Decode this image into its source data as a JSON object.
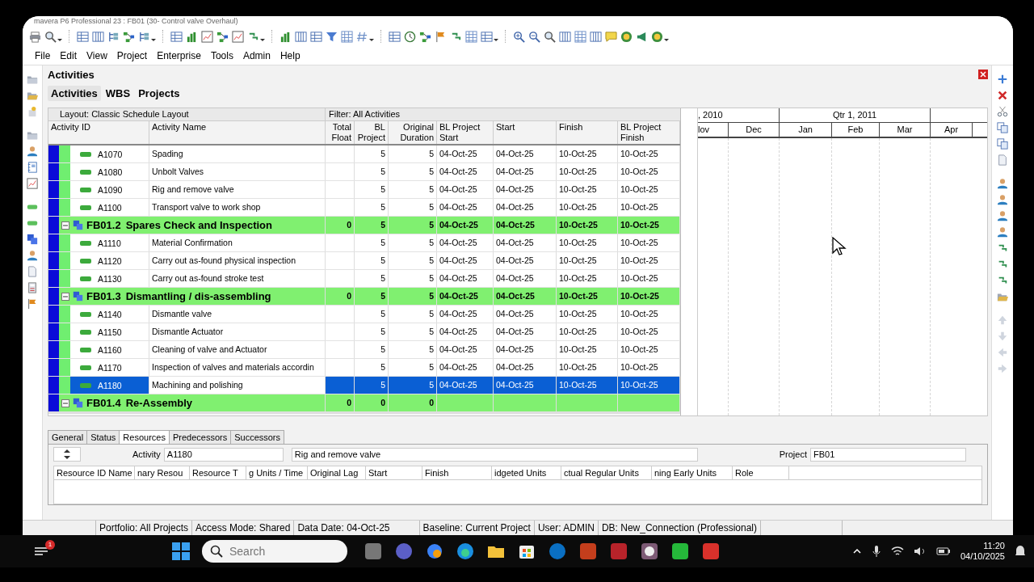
{
  "window": {
    "title": "mavera P6 Professional 23 : FB01 (30- Control valve Overhaul)"
  },
  "menu": [
    "File",
    "Edit",
    "View",
    "Project",
    "Enterprise",
    "Tools",
    "Admin",
    "Help"
  ],
  "panel": {
    "title": "Activities"
  },
  "tabs": [
    {
      "label": "Activities",
      "selected": true
    },
    {
      "label": "WBS",
      "selected": false
    },
    {
      "label": "Projects",
      "selected": false
    }
  ],
  "layout_bar": {
    "layout": "Layout: Classic Schedule Layout",
    "filter": "Filter: All Activities"
  },
  "columns": [
    "Activity ID",
    "Activity Name",
    "Total Float",
    "BL Project",
    "Original Duration",
    "BL Project Start",
    "Start",
    "Finish",
    "BL Project Finish"
  ],
  "rows": [
    {
      "kind": "activity",
      "id": "A1070",
      "name": "Spading",
      "bl_duration": "5",
      "orig_duration": "5",
      "bl_start": "04-Oct-25",
      "start": "04-Oct-25",
      "finish": "10-Oct-25",
      "bl_finish": "10-Oct-25",
      "selected": false
    },
    {
      "kind": "activity",
      "id": "A1080",
      "name": "Unbolt Valves",
      "bl_duration": "5",
      "orig_duration": "5",
      "bl_start": "04-Oct-25",
      "start": "04-Oct-25",
      "finish": "10-Oct-25",
      "bl_finish": "10-Oct-25",
      "selected": false
    },
    {
      "kind": "activity",
      "id": "A1090",
      "name": "Rig and remove valve",
      "bl_duration": "5",
      "orig_duration": "5",
      "bl_start": "04-Oct-25",
      "start": "04-Oct-25",
      "finish": "10-Oct-25",
      "bl_finish": "10-Oct-25",
      "selected": false
    },
    {
      "kind": "activity",
      "id": "A1100",
      "name": "Transport valve to work shop",
      "bl_duration": "5",
      "orig_duration": "5",
      "bl_start": "04-Oct-25",
      "start": "04-Oct-25",
      "finish": "10-Oct-25",
      "bl_finish": "10-Oct-25",
      "selected": false
    },
    {
      "kind": "wbs",
      "code": "FB01.2",
      "name": "Spares Check and Inspection",
      "expanded": true,
      "total_float": "0",
      "bl_duration": "5",
      "orig_duration": "5",
      "bl_start": "04-Oct-25",
      "start": "04-Oct-25",
      "finish": "10-Oct-25",
      "bl_finish": "10-Oct-25",
      "selected": false
    },
    {
      "kind": "activity",
      "id": "A1110",
      "name": "Material Confirmation",
      "bl_duration": "5",
      "orig_duration": "5",
      "bl_start": "04-Oct-25",
      "start": "04-Oct-25",
      "finish": "10-Oct-25",
      "bl_finish": "10-Oct-25",
      "selected": false
    },
    {
      "kind": "activity",
      "id": "A1120",
      "name": "Carry out as-found physical inspection",
      "bl_duration": "5",
      "orig_duration": "5",
      "bl_start": "04-Oct-25",
      "start": "04-Oct-25",
      "finish": "10-Oct-25",
      "bl_finish": "10-Oct-25",
      "selected": false
    },
    {
      "kind": "activity",
      "id": "A1130",
      "name": "Carry out as-found stroke test",
      "bl_duration": "5",
      "orig_duration": "5",
      "bl_start": "04-Oct-25",
      "start": "04-Oct-25",
      "finish": "10-Oct-25",
      "bl_finish": "10-Oct-25",
      "selected": false
    },
    {
      "kind": "wbs",
      "code": "FB01.3",
      "name": "Dismantling / dis-assembling",
      "expanded": true,
      "total_float": "0",
      "bl_duration": "5",
      "orig_duration": "5",
      "bl_start": "04-Oct-25",
      "start": "04-Oct-25",
      "finish": "10-Oct-25",
      "bl_finish": "10-Oct-25",
      "selected": false
    },
    {
      "kind": "activity",
      "id": "A1140",
      "name": "Dismantle valve",
      "bl_duration": "5",
      "orig_duration": "5",
      "bl_start": "04-Oct-25",
      "start": "04-Oct-25",
      "finish": "10-Oct-25",
      "bl_finish": "10-Oct-25",
      "selected": false
    },
    {
      "kind": "activity",
      "id": "A1150",
      "name": "Dismantle Actuator",
      "bl_duration": "5",
      "orig_duration": "5",
      "bl_start": "04-Oct-25",
      "start": "04-Oct-25",
      "finish": "10-Oct-25",
      "bl_finish": "10-Oct-25",
      "selected": false
    },
    {
      "kind": "activity",
      "id": "A1160",
      "name": "Cleaning of valve and Actuator",
      "bl_duration": "5",
      "orig_duration": "5",
      "bl_start": "04-Oct-25",
      "start": "04-Oct-25",
      "finish": "10-Oct-25",
      "bl_finish": "10-Oct-25",
      "selected": false
    },
    {
      "kind": "activity",
      "id": "A1170",
      "name": "Inspection of valves and materials accordin",
      "bl_duration": "5",
      "orig_duration": "5",
      "bl_start": "04-Oct-25",
      "start": "04-Oct-25",
      "finish": "10-Oct-25",
      "bl_finish": "10-Oct-25",
      "selected": false
    },
    {
      "kind": "activity",
      "id": "A1180",
      "name": "Machining and polishing",
      "bl_duration": "5",
      "orig_duration": "5",
      "bl_start": "04-Oct-25",
      "start": "04-Oct-25",
      "finish": "10-Oct-25",
      "bl_finish": "10-Oct-25",
      "selected": true
    },
    {
      "kind": "wbs",
      "code": "FB01.4",
      "name": "Re-Assembly",
      "expanded": true,
      "total_float": "0",
      "bl_duration": "0",
      "orig_duration": "0",
      "selected": false
    }
  ],
  "gantt": {
    "periods": [
      ", 2010",
      "Qtr 1, 2011"
    ],
    "months": [
      "lov",
      "Dec",
      "Jan",
      "Feb",
      "Mar",
      "Apr"
    ]
  },
  "details": {
    "tabs": [
      {
        "label": "General",
        "selected": false
      },
      {
        "label": "Status",
        "selected": false
      },
      {
        "label": "Resources",
        "selected": true
      },
      {
        "label": "Predecessors",
        "selected": false
      },
      {
        "label": "Successors",
        "selected": false
      }
    ],
    "activity_label": "Activity",
    "activity_id": "A1180",
    "activity_name": "Rig and remove valve",
    "project_label": "Project",
    "project": "FB01",
    "columns": [
      "Resource ID Name",
      "nary Resou",
      "Resource T",
      "g Units / Time",
      "Original Lag",
      "Start",
      "Finish",
      "idgeted Units",
      "ctual Regular Units",
      "ning Early Units",
      "Role"
    ]
  },
  "status_bar": [
    "Portfolio: All Projects",
    "Access Mode: Shared",
    "Data Date: 04-Oct-25",
    "Baseline: Current Project",
    "User: ADMIN",
    "DB: New_Connection (Professional)"
  ],
  "taskbar": {
    "badge": "1",
    "search_placeholder": "Search",
    "time": "11:20",
    "date": "04/10/2025"
  }
}
